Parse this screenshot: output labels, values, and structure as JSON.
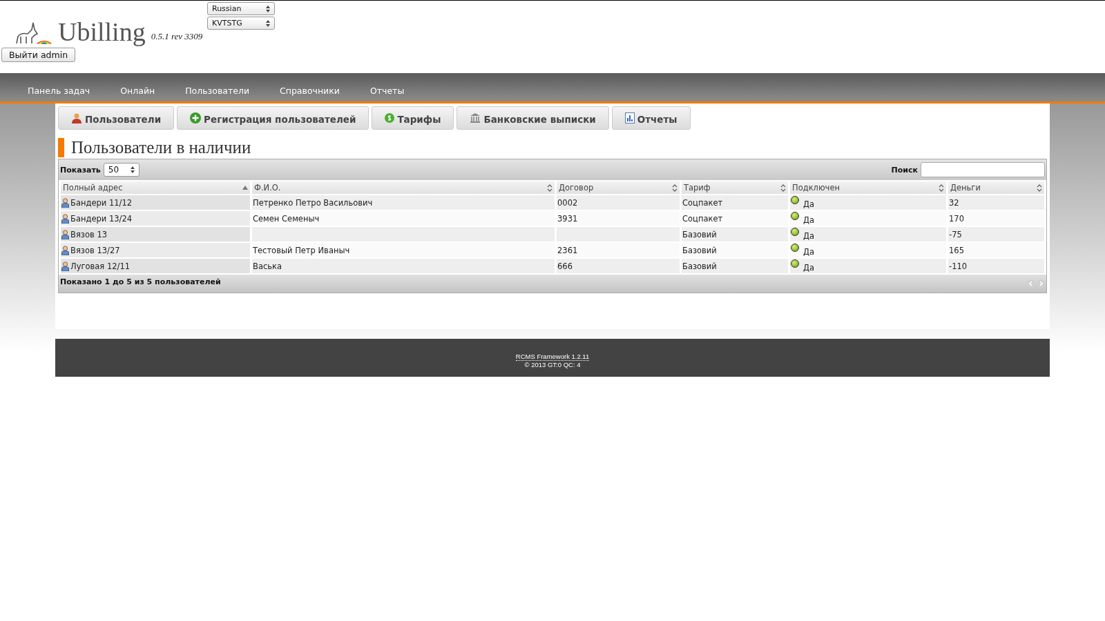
{
  "header": {
    "logo_text": "Ubilling",
    "version": "0.5.1 rev 3309",
    "logout_button": "Выйти admin",
    "language_select": "Russian",
    "skin_select": "KVTSTG"
  },
  "nav": [
    "Панель задач",
    "Онлайн",
    "Пользователи",
    "Справочники",
    "Отчеты"
  ],
  "tabs": [
    {
      "label": "Пользователи",
      "kind": "user"
    },
    {
      "label": "Регистрация пользователей",
      "kind": "plus"
    },
    {
      "label": "Тарифы",
      "kind": "coin"
    },
    {
      "label": "Банковские выписки",
      "kind": "bank"
    },
    {
      "label": "Отчеты",
      "kind": "report"
    }
  ],
  "page_title": "Пользователи в наличии",
  "table": {
    "show_label": "Показать",
    "page_size": "50",
    "search_label": "Поиск",
    "columns": [
      {
        "label": "Полный адрес",
        "sorted": true
      },
      {
        "label": "Ф.И.О.",
        "sorted": false
      },
      {
        "label": "Договор",
        "sorted": false
      },
      {
        "label": "Тариф",
        "sorted": false
      },
      {
        "label": "Подключен",
        "sorted": false
      },
      {
        "label": "Деньги",
        "sorted": false
      }
    ],
    "rows": [
      {
        "address": "Бандери 11/12",
        "name": "Петренко Петро Васильович",
        "contract": "0002",
        "tariff": "Соцпакет",
        "connected": true,
        "connected_text": "Да",
        "money": "32"
      },
      {
        "address": "Бандери 13/24",
        "name": "Семен Семеныч",
        "contract": "3931",
        "tariff": "Соцпакет",
        "connected": true,
        "connected_text": "Да",
        "money": "170"
      },
      {
        "address": "Вязов 13",
        "tariff": "Базовий",
        "connected": true,
        "connected_text": "Да",
        "money": "-75"
      },
      {
        "address": "Вязов 13/27",
        "name": "Тестовый Петр Иваныч",
        "contract": "2361",
        "tariff": "Базовий",
        "connected": true,
        "connected_text": "Да",
        "money": "165"
      },
      {
        "address": "Луговая 12/11",
        "name": "Васька",
        "contract": "666",
        "tariff": "Базовий",
        "connected": true,
        "connected_text": "Да",
        "money": "-110"
      }
    ],
    "info": "Показано 1 до 5 из 5 пользователей"
  },
  "footer": {
    "link": "RCMS Framework 1.2.11",
    "copyright": "© 2013 GT:0 QC: 4"
  }
}
